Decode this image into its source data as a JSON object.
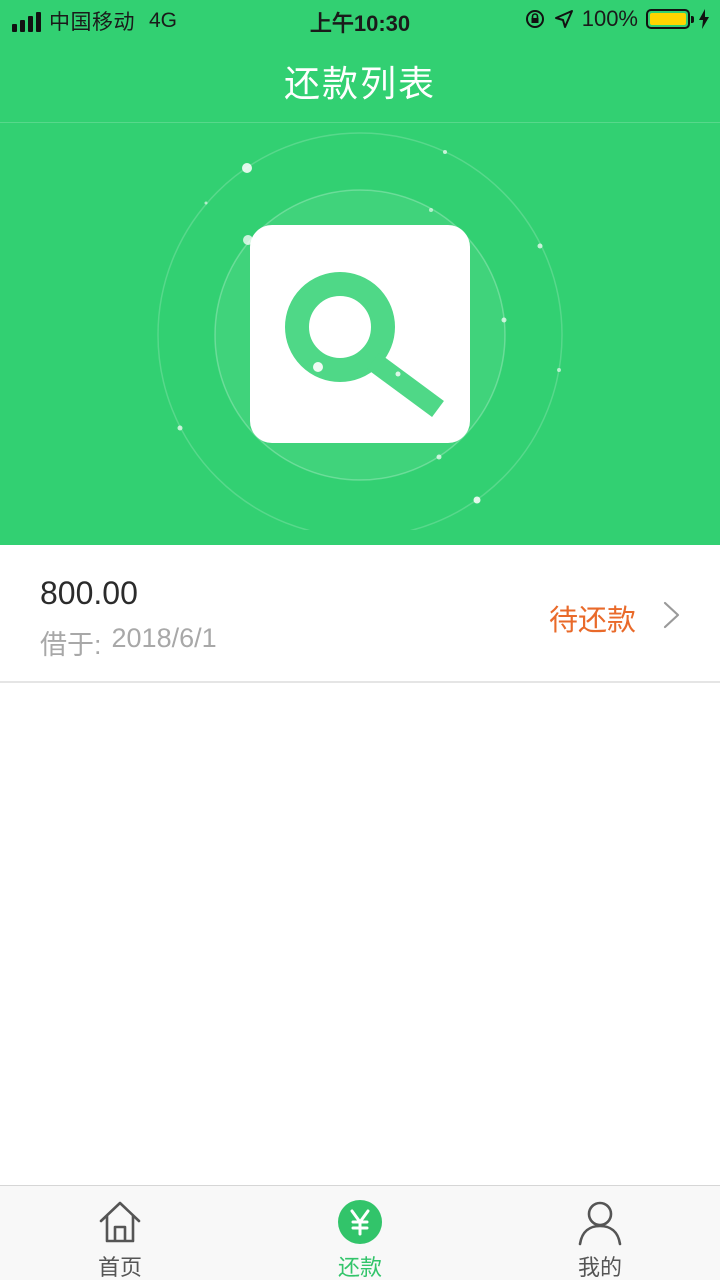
{
  "status_bar": {
    "carrier": "中国移动",
    "network": "4G",
    "time": "上午10:30",
    "battery": "100%"
  },
  "header": {
    "title": "还款列表"
  },
  "records": [
    {
      "amount": "800.00",
      "date_label": "借于:",
      "date": "2018/6/1",
      "status": "待还款"
    }
  ],
  "tabbar": {
    "items": [
      {
        "label": "首页",
        "icon": "home-icon",
        "active": false
      },
      {
        "label": "还款",
        "icon": "yen-icon",
        "active": true
      },
      {
        "label": "我的",
        "icon": "person-icon",
        "active": false
      }
    ]
  },
  "colors": {
    "primary_green": "#32d072",
    "status_orange": "#e96a2a",
    "tab_active": "#32c46a"
  }
}
